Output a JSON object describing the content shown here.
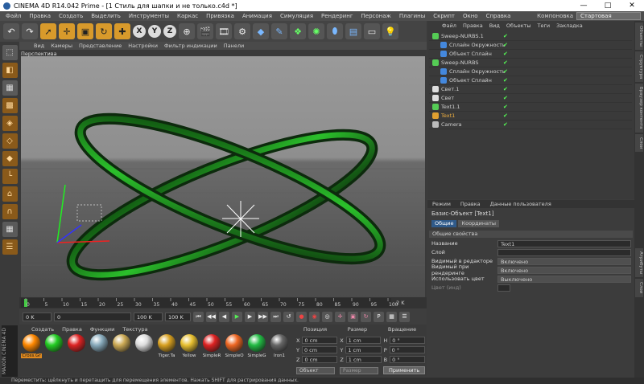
{
  "window": {
    "title": "CINEMA 4D R14.042 Prime - [1 Стиль для шапки и не только.c4d *]",
    "controls": [
      "—",
      "□",
      "✕"
    ]
  },
  "menu": [
    "Файл",
    "Правка",
    "Создать",
    "Выделить",
    "Инструменты",
    "Каркас",
    "Привязка",
    "Анимация",
    "Симуляция",
    "Рендеринг",
    "Персонаж",
    "Плагины",
    "Скрипт",
    "Окно",
    "Справка"
  ],
  "layout": {
    "label": "Компоновка",
    "value": "Стартовая"
  },
  "toolbar": {
    "x": "X",
    "y": "Y",
    "z": "Z"
  },
  "viewport": {
    "menu": [
      "Вид",
      "Камеры",
      "Представление",
      "Настройки",
      "Фильтр индикации",
      "Панели"
    ],
    "label": "Перспектива"
  },
  "timeline": {
    "ticks": [
      "0",
      "5",
      "10",
      "15",
      "20",
      "25",
      "30",
      "35",
      "40",
      "45",
      "50",
      "55",
      "60",
      "65",
      "70",
      "75",
      "80",
      "85",
      "90",
      "95",
      "100"
    ],
    "end_frame": "2 K",
    "start_field": "0 K",
    "scrub_field": "0",
    "end_field": "100 K",
    "max_field": "100 K"
  },
  "materials": {
    "menu": [
      "Создать",
      "Правка",
      "Функции",
      "Текстура"
    ],
    "items": [
      {
        "name": "Cross.Gr",
        "color": "#ff8800"
      },
      {
        "name": "",
        "color": "#22cc22"
      },
      {
        "name": "",
        "color": "#dd2222"
      },
      {
        "name": "",
        "color": "#88aabb"
      },
      {
        "name": "",
        "color": "#ccaa55"
      },
      {
        "name": "",
        "color": "#dddddd"
      },
      {
        "name": "Tiger.Ta",
        "color": "#d8a020"
      },
      {
        "name": "Yellow",
        "color": "#e8c030"
      },
      {
        "name": "SimpleR",
        "color": "#dd2222"
      },
      {
        "name": "SimpleO",
        "color": "#ee6622"
      },
      {
        "name": "SimpleG",
        "color": "#22bb44"
      },
      {
        "name": "Iron1",
        "color": "#666666"
      }
    ],
    "brand": "MAXON CINEMA 4D"
  },
  "coords": {
    "headers": [
      "Позиция",
      "Размер",
      "Вращение"
    ],
    "rows": [
      {
        "axis": "X",
        "pos": "0 cm",
        "size": "1 cm",
        "rot_axis": "H",
        "rot": "0 °"
      },
      {
        "axis": "Y",
        "pos": "0 cm",
        "size": "1 cm",
        "rot_axis": "P",
        "rot": "0 °"
      },
      {
        "axis": "Z",
        "pos": "0 cm",
        "size": "1 cm",
        "rot_axis": "B",
        "rot": "0 °"
      }
    ],
    "mode": "Объект",
    "size_mode": "Размер",
    "apply": "Применить"
  },
  "objects": {
    "menu": [
      "Файл",
      "Правка",
      "Вид",
      "Объекты",
      "Теги",
      "Закладка"
    ],
    "rows": [
      {
        "name": "Sweep-NURBS.1",
        "indent": 0,
        "color": "#55cc55"
      },
      {
        "name": "Сплайн Окружность",
        "indent": 1,
        "color": "#4488dd"
      },
      {
        "name": "Объект Сплайн",
        "indent": 1,
        "color": "#4488dd"
      },
      {
        "name": "Sweep-NURBS",
        "indent": 0,
        "color": "#55cc55"
      },
      {
        "name": "Сплайн Окружность",
        "indent": 1,
        "color": "#4488dd"
      },
      {
        "name": "Объект Сплайн",
        "indent": 1,
        "color": "#4488dd"
      },
      {
        "name": "Свет.1",
        "indent": 0,
        "color": "#dddddd"
      },
      {
        "name": "Свет",
        "indent": 0,
        "color": "#dddddd"
      },
      {
        "name": "Text1.1",
        "indent": 0,
        "color": "#55cc55"
      },
      {
        "name": "Text1",
        "indent": 0,
        "color": "#e0a030"
      },
      {
        "name": "Camera",
        "indent": 0,
        "color": "#bbbbbb"
      }
    ]
  },
  "attributes": {
    "tabs": [
      "Режим",
      "Правка",
      "Данные пользователя"
    ],
    "title": "Базис-Объект [Text1]",
    "subtabs": [
      "Общие",
      "Координаты"
    ],
    "section": "Общие свойства",
    "rows": [
      {
        "label": "Название",
        "value": "Text1"
      },
      {
        "label": "Слой",
        "value": ""
      },
      {
        "label": "Видимый в редакторе",
        "value": "Включено"
      },
      {
        "label": "Видимый при рендеринге",
        "value": "Включено"
      },
      {
        "label": "Использовать цвет",
        "value": "Выключено"
      },
      {
        "label": "Цвет (инд)",
        "value": ""
      }
    ]
  },
  "right_tabs": [
    "Объекты",
    "Структура",
    "Браузер контента",
    "Слои",
    "Атрибуты",
    "Слои"
  ],
  "status": "Переместить: щёлкнуть и перетащить для перемещения элементов. Нажать SHIFT для растрирования данных."
}
